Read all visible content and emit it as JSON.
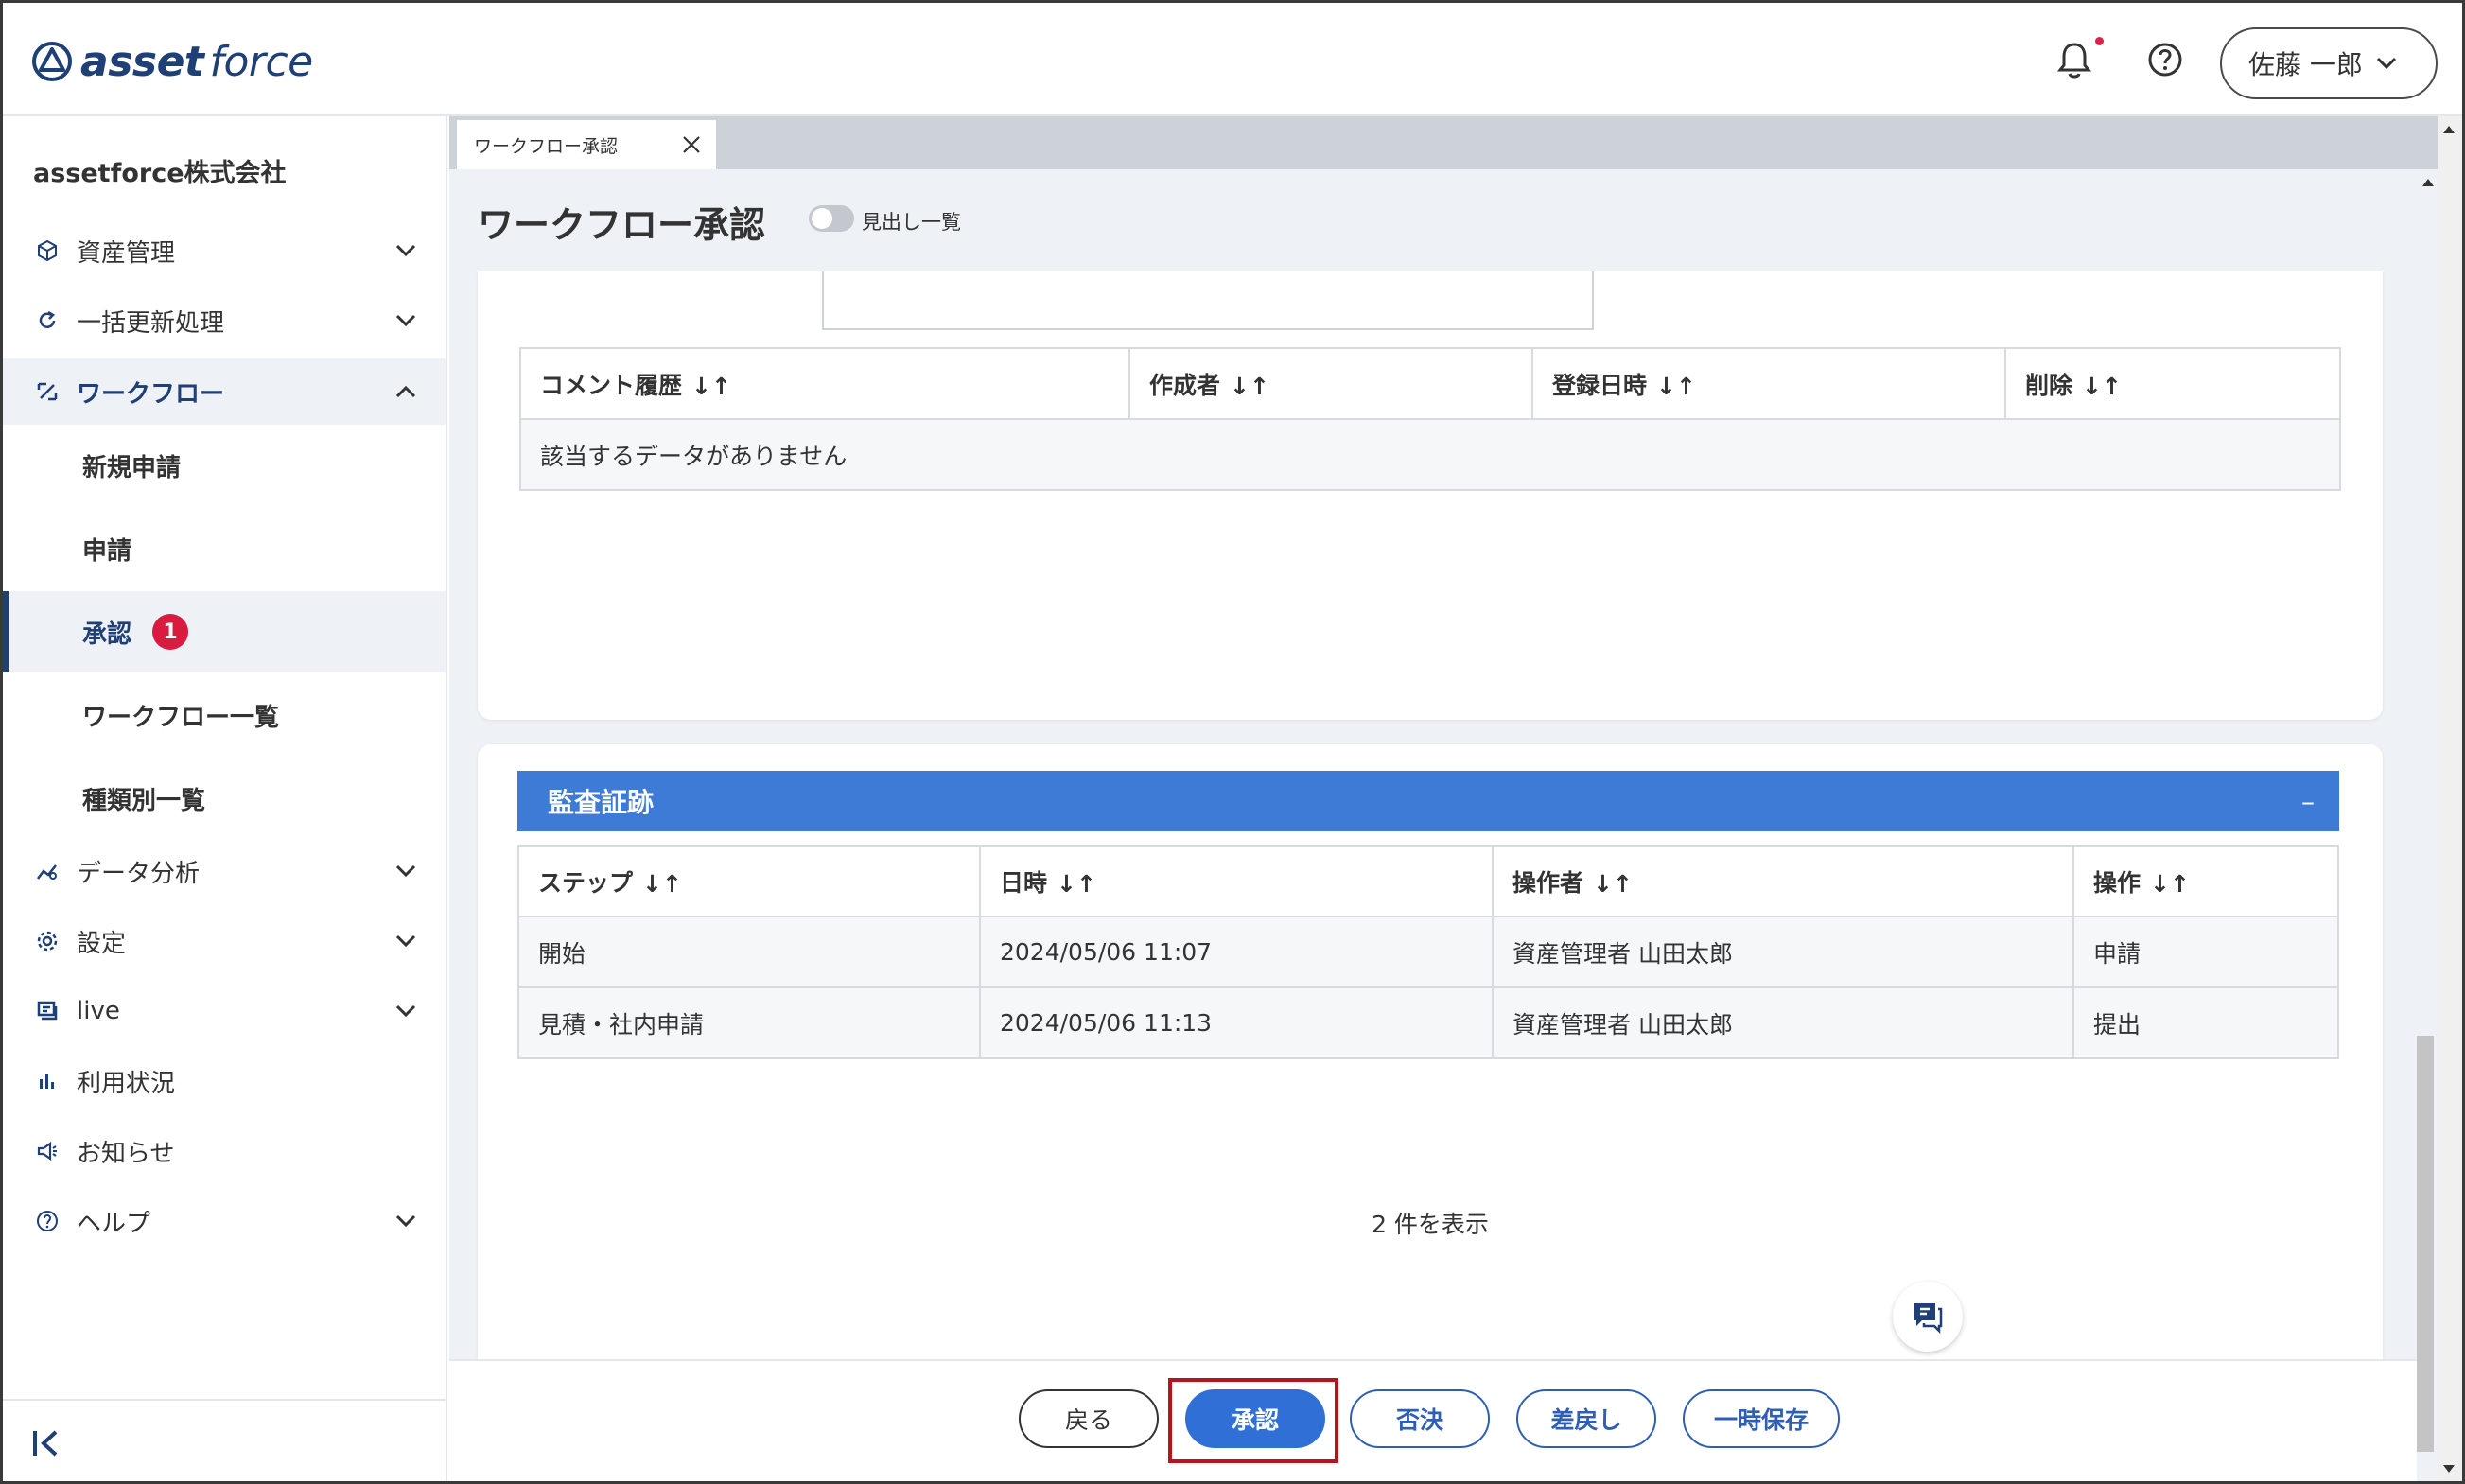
{
  "header": {
    "logo_bold": "asset",
    "logo_light": "force",
    "user_name": "佐藤 一郎",
    "icons": [
      "bell-icon",
      "help-icon",
      "chevron-down-icon"
    ]
  },
  "sidebar": {
    "company": "assetforce株式会社",
    "items": [
      {
        "label": "資産管理",
        "icon": "box-icon"
      },
      {
        "label": "一括更新処理",
        "icon": "refresh-icon"
      },
      {
        "label": "ワークフロー",
        "icon": "workflow-icon"
      },
      {
        "label": "データ分析",
        "icon": "analytics-icon"
      },
      {
        "label": "設定",
        "icon": "gear-icon"
      },
      {
        "label": "live",
        "icon": "live-icon"
      },
      {
        "label": "利用状況",
        "icon": "bar-chart-icon"
      },
      {
        "label": "お知らせ",
        "icon": "megaphone-icon"
      },
      {
        "label": "ヘルプ",
        "icon": "help-icon"
      }
    ],
    "workflow_sub": [
      {
        "label": "新規申請"
      },
      {
        "label": "申請"
      },
      {
        "label": "承認",
        "badge": "1"
      },
      {
        "label": "ワークフロー一覧"
      },
      {
        "label": "種類別一覧"
      }
    ]
  },
  "tab": {
    "label": "ワークフロー承認"
  },
  "page": {
    "title": "ワークフロー承認",
    "toggle_label": "見出し一覧"
  },
  "comments": {
    "headers": [
      "コメント履歴",
      "作成者",
      "登録日時",
      "削除"
    ],
    "empty": "該当するデータがありません"
  },
  "audit": {
    "title": "監査証跡",
    "collapse": "–",
    "headers": [
      "ステップ",
      "日時",
      "操作者",
      "操作"
    ],
    "rows": [
      [
        "開始",
        "2024/05/06 11:07",
        "資産管理者 山田太郎",
        "申請"
      ],
      [
        "見積・社内申請",
        "2024/05/06 11:13",
        "資産管理者 山田太郎",
        "提出"
      ]
    ],
    "count": "2 件を表示"
  },
  "footer": {
    "back": "戻る",
    "approve": "承認",
    "reject": "否決",
    "return": "差戻し",
    "save": "一時保存"
  },
  "colors": {
    "brand": "#1f3f77",
    "accent": "#3e7bd7",
    "primary_button": "#2f6fd6",
    "badge": "#d81b3f",
    "highlight": "#b8141e"
  }
}
